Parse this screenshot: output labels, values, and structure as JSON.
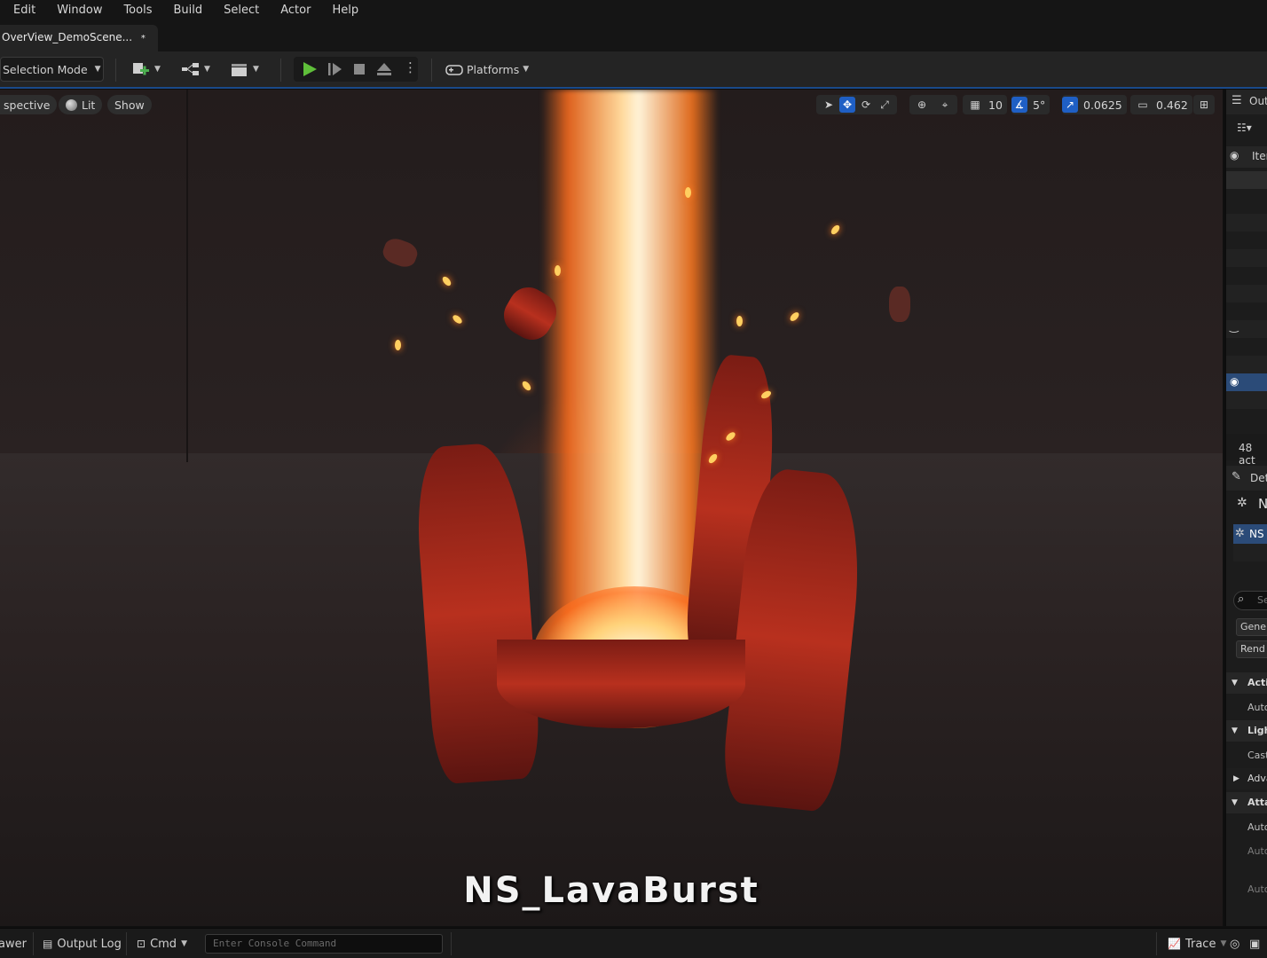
{
  "menu": [
    "Edit",
    "Window",
    "Tools",
    "Build",
    "Select",
    "Actor",
    "Help"
  ],
  "tab": {
    "title": "OverView_DemoScene...",
    "dirty_marker": "*"
  },
  "toolbar": {
    "selection_mode": "Selection Mode",
    "platforms": "Platforms"
  },
  "viewport": {
    "perspective": "spective",
    "lit": "Lit",
    "show": "Show",
    "grid_snap": "10",
    "rotation_snap": "5°",
    "scale_snap": "0.0625",
    "camera_speed": "0.462",
    "caption": "NS_LavaBurst",
    "accent": "#1f5fc4"
  },
  "outliner": {
    "title": "Out",
    "column_item": "Iter",
    "actor_count": "48 act"
  },
  "details": {
    "title": "Det",
    "actor_name": "N",
    "component": "NS",
    "search_placeholder": "Se",
    "filter_general": "Gene",
    "filter_rendering": "Rend",
    "section_activation": "Activ",
    "prop_auto_activate": "Auto",
    "section_lighting": "Light",
    "prop_cast": "Cast",
    "section_advanced": "Adva",
    "section_attachment": "Attac",
    "prop_auto1": "Auto",
    "prop_auto2": "Auto",
    "prop_auto3": "Auto"
  },
  "bottom": {
    "drawer": "awer",
    "output_log": "Output Log",
    "cmd": "Cmd",
    "console_placeholder": "Enter Console Command",
    "trace": "Trace"
  }
}
